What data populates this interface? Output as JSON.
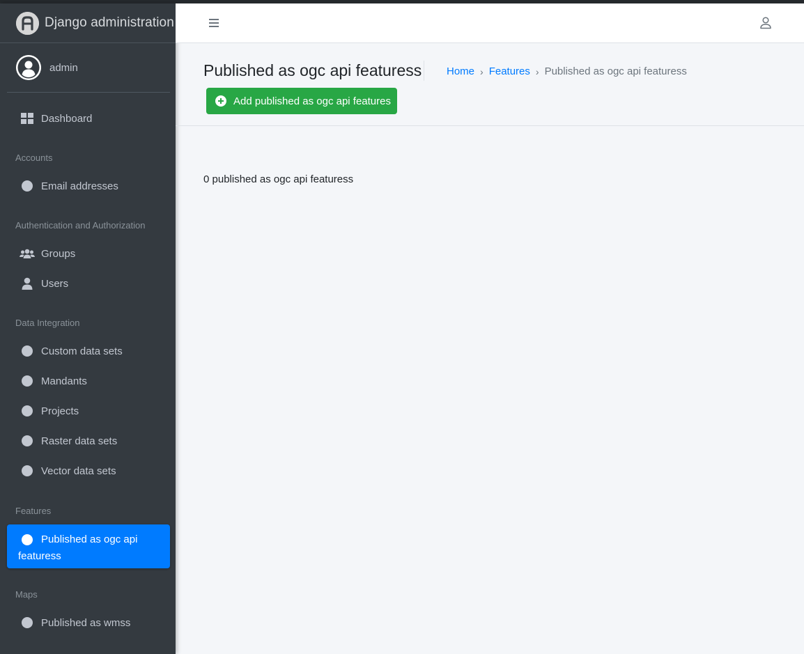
{
  "brand": {
    "title": "Django administration"
  },
  "user": {
    "name": "admin"
  },
  "sidebar": {
    "dashboard": "Dashboard",
    "sections": {
      "accounts": "Accounts",
      "auth": "Authentication and Authorization",
      "data_integration": "Data Integration",
      "features": "Features",
      "maps": "Maps"
    },
    "items": {
      "email_addresses": "Email addresses",
      "groups": "Groups",
      "users": "Users",
      "custom_data_sets": "Custom data sets",
      "mandants": "Mandants",
      "projects": "Projects",
      "raster_data_sets": "Raster data sets",
      "vector_data_sets": "Vector data sets",
      "published_ogc_line1": "Published as ogc api",
      "published_ogc_line2": "featuress",
      "published_wmss": "Published as wmss"
    },
    "active_item": "Published as ogc api featuress"
  },
  "header": {
    "page_title": "Published as ogc api featuress",
    "breadcrumb": {
      "home": "Home",
      "features": "Features",
      "current": "Published as ogc api featuress",
      "separator": "›"
    },
    "add_button": "Add published as ogc api features"
  },
  "content": {
    "result_count": "0 published as ogc api featuress"
  },
  "colors": {
    "sidebar_bg": "#343a40",
    "active": "#007bff",
    "add_button": "#28a745",
    "content_bg": "#f4f6f9"
  }
}
